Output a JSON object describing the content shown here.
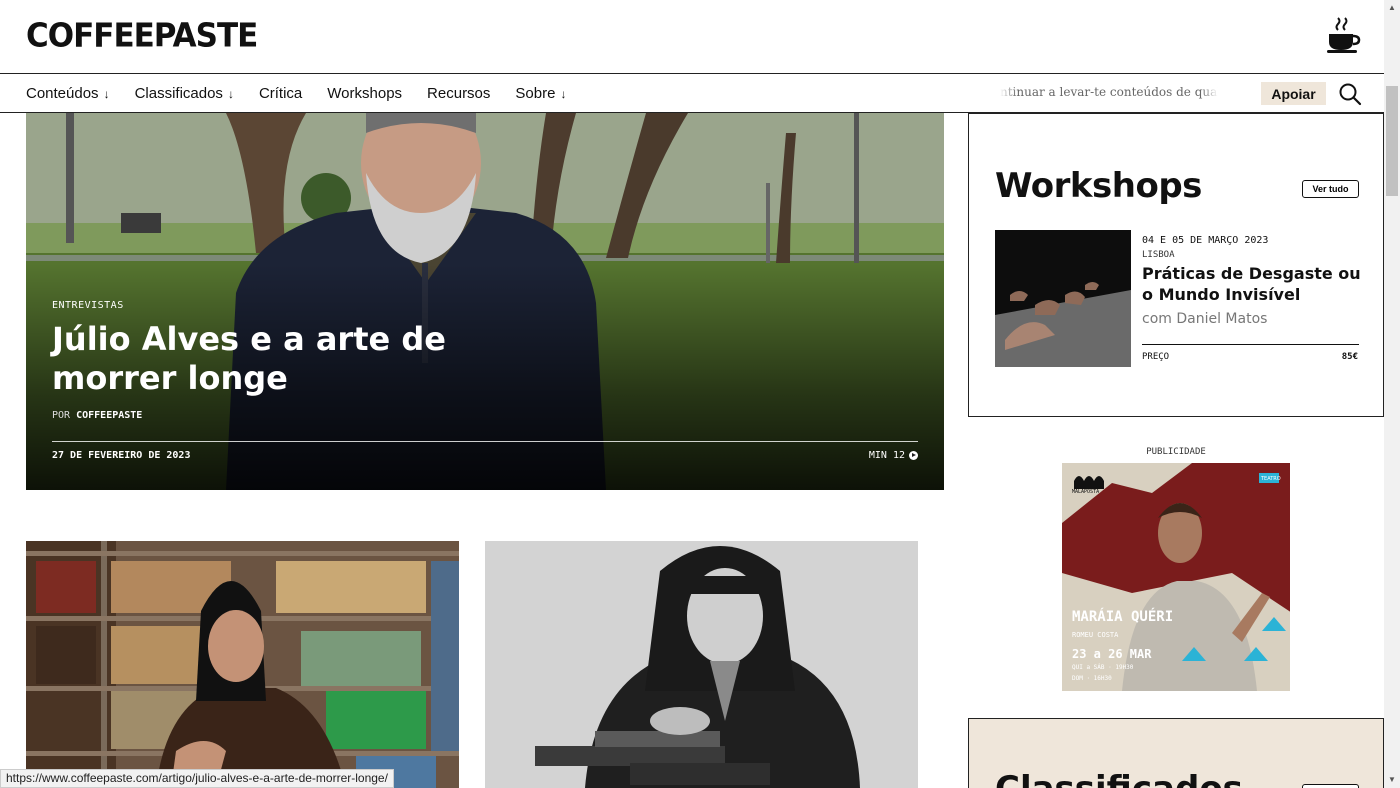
{
  "header": {
    "logo": "COFFEEPASTE"
  },
  "nav": {
    "items": [
      {
        "label": "Conteúdos",
        "arrow": "↓"
      },
      {
        "label": "Classificados",
        "arrow": "↓"
      },
      {
        "label": "Crítica",
        "arrow": ""
      },
      {
        "label": "Workshops",
        "arrow": ""
      },
      {
        "label": "Recursos",
        "arrow": ""
      },
      {
        "label": "Sobre",
        "arrow": "↓"
      }
    ],
    "ticker": "ntinuar a levar-te conteúdos de qualidade",
    "support_label": "Apoiar"
  },
  "hero": {
    "category": "ENTREVISTAS",
    "title": "Júlio Alves e a arte de morrer longe",
    "by_prefix": "POR",
    "author": "COFFEEPASTE",
    "date": "27 DE FEVEREIRO DE 2023",
    "read_time": "MIN 12"
  },
  "workshops": {
    "heading": "Workshops",
    "see_all": "Ver tudo",
    "item": {
      "date": "04 E 05 DE MARÇO 2023",
      "location": "LISBOA",
      "title": "Práticas de Desgaste ou o Mundo Invisível",
      "with": "com Daniel Matos",
      "price_label": "PREÇO",
      "price": "85€"
    }
  },
  "ad": {
    "label": "PUBLICIDADE",
    "brand": "MALAPOSTA",
    "badge": "TEATRO",
    "title": "MARÁIA QUÉRI",
    "author": "ROMEU COSTA",
    "dates": "23 a 26 MAR",
    "times1": "QUI a SÁB · 19H30",
    "times2": "DOM · 16H30"
  },
  "classificados": {
    "heading": "Classificados"
  },
  "status_url": "https://www.coffeepaste.com/artigo/julio-alves-e-a-arte-de-morrer-longe/",
  "colors": {
    "accent_beige": "#efe6da",
    "ad_red": "#7a1c1c",
    "ad_cyan": "#2bb3d6"
  }
}
